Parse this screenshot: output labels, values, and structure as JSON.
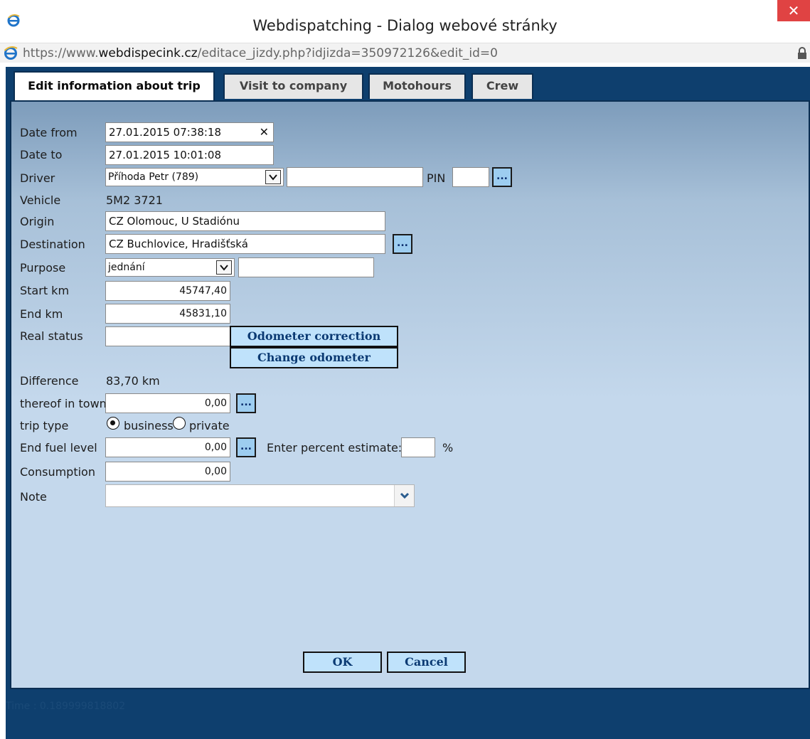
{
  "window": {
    "title": "Webdispatching - Dialog webové stránky",
    "close_glyph": "✕",
    "icon": "ie-icon"
  },
  "address": {
    "prefix": "https://www.",
    "domain": "webdispecink.cz",
    "path": "/editace_jizdy.php?idjizda=350972126&edit_id=0"
  },
  "tabs": [
    {
      "label": "Edit information about trip",
      "active": true
    },
    {
      "label": "Visit to company",
      "active": false
    },
    {
      "label": "Motohours",
      "active": false
    },
    {
      "label": "Crew",
      "active": false
    }
  ],
  "form": {
    "date_from": {
      "label": "Date from",
      "value": "27.01.2015 07:38:18",
      "clear": "✕"
    },
    "date_to": {
      "label": "Date to",
      "value": "27.01.2015 10:01:08"
    },
    "driver": {
      "label": "Driver",
      "selected": "Příhoda Petr (789)",
      "extra": "",
      "pin_label": "PIN",
      "pin_value": "",
      "lookup": "..."
    },
    "vehicle": {
      "label": "Vehicle",
      "value": "5M2 3721"
    },
    "origin": {
      "label": "Origin",
      "value": "CZ Olomouc, U Stadiónu"
    },
    "destination": {
      "label": "Destination",
      "value": "CZ Buchlovice, Hradišťská",
      "lookup": "..."
    },
    "purpose": {
      "label": "Purpose",
      "selected": "jednání",
      "extra": ""
    },
    "start_km": {
      "label": "Start km",
      "value": "45747,40"
    },
    "end_km": {
      "label": "End km",
      "value": "45831,10"
    },
    "real_status": {
      "label": "Real status",
      "value": "",
      "btn_correction": "Odometer correction",
      "btn_change": "Change odometer"
    },
    "difference": {
      "label": "Difference",
      "value": "83,70 km"
    },
    "in_town": {
      "label": "thereof in town",
      "value": "0,00",
      "lookup": "..."
    },
    "trip_type": {
      "label": "trip type",
      "options": [
        "business",
        "private"
      ],
      "selected": "business"
    },
    "end_fuel": {
      "label": "End fuel level",
      "value": "0,00",
      "lookup": "...",
      "estimate_label": "Enter percent estimate:",
      "estimate_value": "",
      "unit": "%"
    },
    "consumption": {
      "label": "Consumption",
      "value": "0,00"
    },
    "note": {
      "label": "Note",
      "value": ""
    }
  },
  "buttons": {
    "ok": "OK",
    "cancel": "Cancel"
  },
  "footer": {
    "time": "Time : 0.189999818802"
  }
}
